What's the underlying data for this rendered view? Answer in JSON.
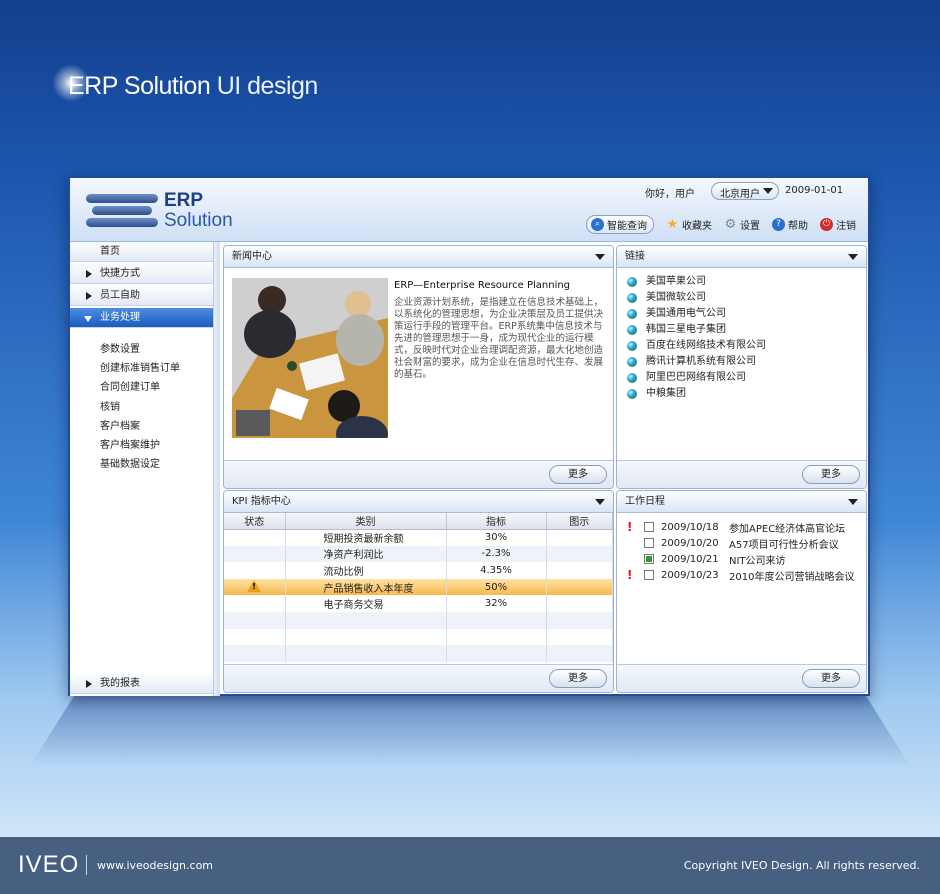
{
  "page": {
    "title_bold": "ERP Solution",
    "title_thin": "UI design"
  },
  "header": {
    "logo_erp": "ERP",
    "logo_solution": "Solution",
    "greeting": "你好，用户",
    "user_select": "北京用户",
    "date": "2009-01-01",
    "toolbar": [
      {
        "label": "智能查询",
        "icon": "search-icon",
        "color": "#2b6fd1"
      },
      {
        "label": "收藏夹",
        "icon": "star-icon",
        "color": "#f2b21a"
      },
      {
        "label": "设置",
        "icon": "gear-icon",
        "color": "#8a8f98"
      },
      {
        "label": "帮助",
        "icon": "help-icon",
        "color": "#2b6fd1"
      },
      {
        "label": "注销",
        "icon": "power-icon",
        "color": "#d62a2a"
      }
    ]
  },
  "sidebar": {
    "items": [
      {
        "label": "首页"
      },
      {
        "label": "快捷方式"
      },
      {
        "label": "员工自助"
      },
      {
        "label": "业务处理"
      }
    ],
    "sub_items": [
      "参数设置",
      "创建标准销售订单",
      "合同创建订单",
      "核销",
      "客户档案",
      "客户档案维护",
      "基础数据设定"
    ],
    "bottom_item": "我的报表"
  },
  "news": {
    "title": "新闻中心",
    "heading": "ERP—Enterprise Resource Planning",
    "body": "企业资源计划系统，是指建立在信息技术基础上，以系统化的管理思想，为企业决策层及员工提供决策运行手段的管理平台。ERP系统集中信息技术与先进的管理思想于一身，成为现代企业的运行模式，反映时代对企业合理调配资源，最大化地创造社会财富的要求，成为企业在信息时代生存、发展的基石。",
    "more": "更多"
  },
  "links": {
    "title": "链接",
    "items": [
      "美国苹果公司",
      "美国微软公司",
      "美国通用电气公司",
      "韩国三星电子集团",
      "百度在线网络技术有限公司",
      "腾讯计算机系统有限公司",
      "阿里巴巴网络有限公司",
      "中粮集团"
    ],
    "more": "更多"
  },
  "kpi": {
    "title": "KPI 指标中心",
    "columns": [
      "状态",
      "类别",
      "指标",
      "图示"
    ],
    "rows": [
      {
        "category": "短期投资最新余额",
        "value": "30%",
        "warn": false
      },
      {
        "category": "净资产利润比",
        "value": "-2.3%",
        "warn": false
      },
      {
        "category": "流动比例",
        "value": "4.35%",
        "warn": false
      },
      {
        "category": "产品销售收入本年度",
        "value": "50%",
        "warn": true
      },
      {
        "category": "电子商务交易",
        "value": "32%",
        "warn": false
      }
    ],
    "more": "更多"
  },
  "schedule": {
    "title": "工作日程",
    "items": [
      {
        "date": "2009/10/18",
        "text": "参加APEC经济体高官论坛",
        "urgent": true,
        "checked": false
      },
      {
        "date": "2009/10/20",
        "text": "A57项目可行性分析会议",
        "urgent": false,
        "checked": false
      },
      {
        "date": "2009/10/21",
        "text": "NIT公司来访",
        "urgent": false,
        "checked": true
      },
      {
        "date": "2009/10/23",
        "text": "2010年度公司营销战略会议",
        "urgent": true,
        "checked": false
      }
    ],
    "more": "更多"
  },
  "footer": {
    "brand": "IVEO",
    "url": "www.iveodesign.com",
    "copyright": "Copyright IVEO Design. All rights reserved."
  }
}
